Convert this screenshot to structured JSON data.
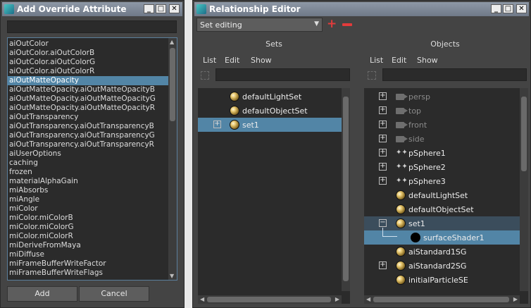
{
  "add_override": {
    "title": "Add Override Attribute",
    "search_value": "",
    "attributes": [
      "aiOutColor",
      "aiOutColor.aiOutColorB",
      "aiOutColor.aiOutColorG",
      "aiOutColor.aiOutColorR",
      "aiOutMatteOpacity",
      "aiOutMatteOpacity.aiOutMatteOpacityB",
      "aiOutMatteOpacity.aiOutMatteOpacityG",
      "aiOutMatteOpacity.aiOutMatteOpacityR",
      "aiOutTransparency",
      "aiOutTransparency.aiOutTransparencyB",
      "aiOutTransparency.aiOutTransparencyG",
      "aiOutTransparency.aiOutTransparencyR",
      "aiUserOptions",
      "caching",
      "frozen",
      "materialAlphaGain",
      "miAbsorbs",
      "miAngle",
      "miColor",
      "miColor.miColorB",
      "miColor.miColorG",
      "miColor.miColorR",
      "miDeriveFromMaya",
      "miDiffuse",
      "miFrameBufferWriteFactor",
      "miFrameBufferWriteFlags"
    ],
    "selected_attribute": "aiOutMatteOpacity",
    "add_label": "Add",
    "cancel_label": "Cancel"
  },
  "relationship_editor": {
    "title": "Relationship Editor",
    "mode": "Set editing",
    "sets_panel": {
      "heading": "Sets",
      "menu": [
        "List",
        "Edit",
        "Show"
      ],
      "filter_value": "",
      "items": [
        {
          "label": "defaultLightSet",
          "icon": "shader-sphere-icon",
          "expandable": false,
          "selected": false
        },
        {
          "label": "defaultObjectSet",
          "icon": "shader-sphere-icon",
          "expandable": false,
          "selected": false
        },
        {
          "label": "set1",
          "icon": "shader-sphere-icon",
          "expandable": true,
          "selected": true
        }
      ]
    },
    "objects_panel": {
      "heading": "Objects",
      "menu": [
        "List",
        "Edit",
        "Show"
      ],
      "filter_value": "",
      "items": [
        {
          "label": "persp",
          "icon": "camera-icon",
          "expandable": true,
          "dim": true
        },
        {
          "label": "top",
          "icon": "camera-icon",
          "expandable": true,
          "dim": true
        },
        {
          "label": "front",
          "icon": "camera-icon",
          "expandable": true,
          "dim": true
        },
        {
          "label": "side",
          "icon": "camera-icon",
          "expandable": true,
          "dim": true
        },
        {
          "label": "pSphere1",
          "icon": "mesh-icon",
          "expandable": true,
          "dim": false
        },
        {
          "label": "pSphere2",
          "icon": "mesh-icon",
          "expandable": true,
          "dim": false
        },
        {
          "label": "pSphere3",
          "icon": "mesh-icon",
          "expandable": true,
          "dim": false
        },
        {
          "label": "defaultLightSet",
          "icon": "shader-sphere-icon",
          "expandable": false,
          "dim": false
        },
        {
          "label": "defaultObjectSet",
          "icon": "shader-sphere-icon",
          "expandable": false,
          "dim": false
        },
        {
          "label": "set1",
          "icon": "shader-sphere-icon",
          "expandable": true,
          "expanded": true,
          "dim": false
        },
        {
          "label": "surfaceShader1",
          "icon": "black-sphere-icon",
          "child": true,
          "selected": true,
          "dim": false
        },
        {
          "label": "aiStandard1SG",
          "icon": "shader-sphere-icon",
          "expandable": false,
          "dim": false
        },
        {
          "label": "aiStandard2SG",
          "icon": "shader-sphere-icon",
          "expandable": true,
          "dim": false
        },
        {
          "label": "initialParticleSE",
          "icon": "shader-sphere-icon",
          "expandable": false,
          "dim": false
        }
      ]
    }
  },
  "colors": {
    "panel_bg": "#444444",
    "field_bg": "#2b2b2b",
    "selection": "#5285a6",
    "add_icon": "#e23b3b",
    "remove_icon": "#e23b3b"
  }
}
